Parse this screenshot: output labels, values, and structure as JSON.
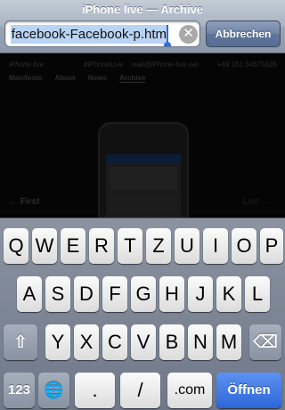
{
  "page": {
    "title": "iPhone live — Archive"
  },
  "address_bar": {
    "value": "facebook-Facebook-p.htm",
    "cancel_label": "Abbrechen",
    "clear_icon": "✕"
  },
  "webpage": {
    "brand": "iPhone live",
    "hashtag": "#iPhoneLive",
    "email": "mail@iPhone-live.net",
    "phone": "+49 151 54675635",
    "nav": [
      "Manifesto",
      "About",
      "News",
      "Archive"
    ],
    "first_link": "← First",
    "last_link": "Last →"
  },
  "keyboard": {
    "row1": [
      "Q",
      "W",
      "E",
      "R",
      "T",
      "Z",
      "U",
      "I",
      "O",
      "P"
    ],
    "row2": [
      "A",
      "S",
      "D",
      "F",
      "G",
      "H",
      "J",
      "K",
      "L"
    ],
    "row3": [
      "Y",
      "X",
      "C",
      "V",
      "B",
      "N",
      "M"
    ],
    "shift_icon": "⇧",
    "delete_icon": "⌫",
    "numbers_label": "123",
    "globe_icon": "🌐",
    "dot_label": ".",
    "slash_label": "/",
    "dotcom_label": ".com",
    "go_label": "Öffnen"
  }
}
